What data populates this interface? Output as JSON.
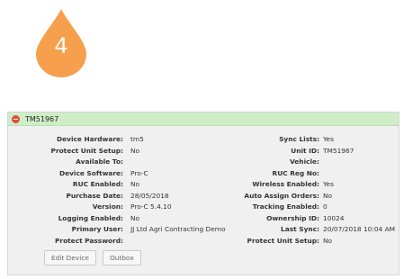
{
  "step_badge": {
    "number": "4",
    "color": "#f6a04d"
  },
  "panel": {
    "title": "TM51967",
    "header_color": "#cfeec7",
    "collapse_icon": "minus-circle-icon",
    "left_fields": [
      {
        "label": "Device Hardware:",
        "value": "tm5"
      },
      {
        "label": "Protect Unit Setup:",
        "value": "No"
      },
      {
        "label": "Available To:",
        "value": ""
      },
      {
        "label": "Device Software:",
        "value": "Pro-C"
      },
      {
        "label": "RUC Enabled:",
        "value": "No"
      },
      {
        "label": "Purchase Date:",
        "value": "28/05/2018"
      },
      {
        "label": "Version:",
        "value": "Pro-C 5.4.10"
      },
      {
        "label": "Logging Enabled:",
        "value": "No"
      },
      {
        "label": "Primary User:",
        "value": "JJ Ltd Agri Contracting Demo"
      },
      {
        "label": "Protect Password:",
        "value": ""
      }
    ],
    "right_fields": [
      {
        "label": "Sync Lists:",
        "value": "Yes"
      },
      {
        "label": "Unit ID:",
        "value": "TM51967"
      },
      {
        "label": "Vehicle:",
        "value": ""
      },
      {
        "label": "RUC Reg No:",
        "value": ""
      },
      {
        "label": "Wireless Enabled:",
        "value": "Yes"
      },
      {
        "label": "Auto Assign Orders:",
        "value": "No"
      },
      {
        "label": "Tracking Enabled:",
        "value": "0"
      },
      {
        "label": "Ownership ID:",
        "value": "10024"
      },
      {
        "label": "Last Sync:",
        "value": "20/07/2018 10:04 AM"
      },
      {
        "label": "Protect Unit Setup:",
        "value": "No"
      }
    ],
    "buttons": {
      "edit_device": "Edit Device",
      "outbox": "Outbox"
    }
  }
}
